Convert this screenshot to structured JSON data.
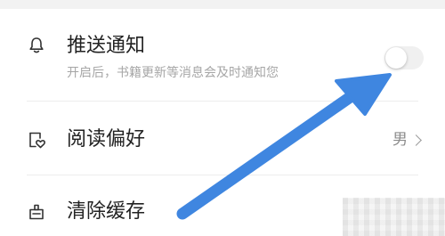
{
  "settings": {
    "push": {
      "title": "推送通知",
      "subtitle": "开启后，书籍更新等消息会及时通知您",
      "enabled": false,
      "icon": "bell-icon"
    },
    "reading_pref": {
      "title": "阅读偏好",
      "value": "男",
      "icon": "heart-tag-icon"
    },
    "clear_cache": {
      "title": "清除缓存",
      "icon": "broom-icon"
    }
  },
  "annotation": {
    "arrow_color": "#3f86e0"
  }
}
